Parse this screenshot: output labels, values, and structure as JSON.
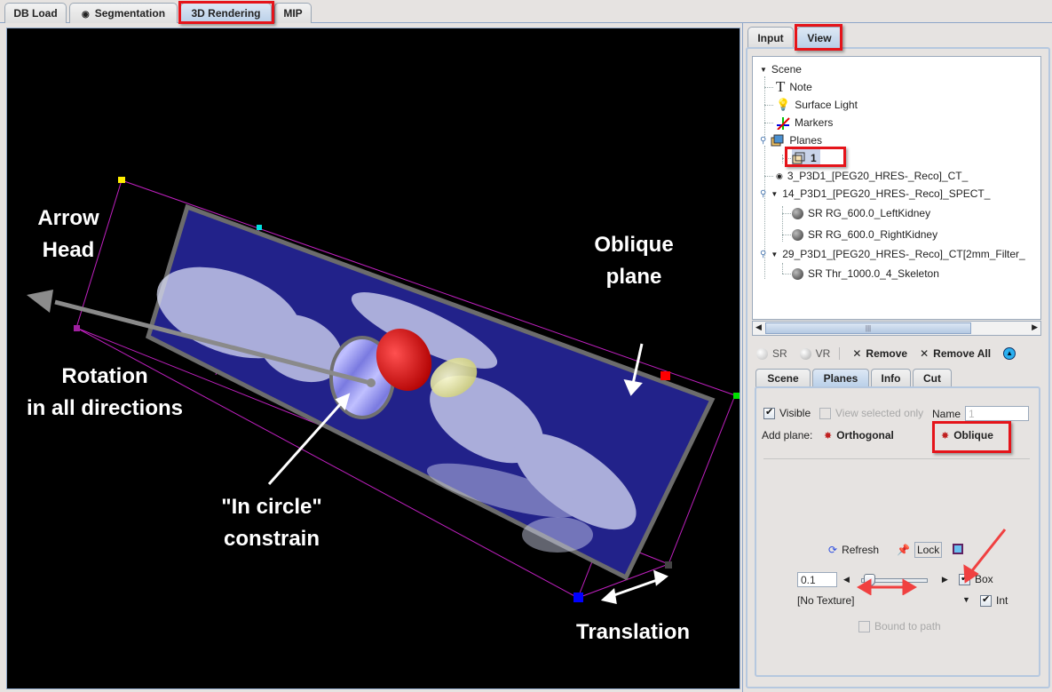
{
  "top_tabs": [
    {
      "label": "DB Load",
      "active": false
    },
    {
      "label": "Segmentation",
      "active": false,
      "icon": "target-icon"
    },
    {
      "label": "3D Rendering",
      "active": true
    },
    {
      "label": "MIP",
      "active": false
    }
  ],
  "viewport": {
    "annotations": {
      "arrow_head": "Arrow\nHead",
      "oblique_plane": "Oblique\nplane",
      "rotation": "Rotation\nin all directions",
      "in_circle": "\"In circle\"\nconstrain",
      "translation": "Translation"
    }
  },
  "side_tabs": [
    {
      "label": "Input",
      "active": false
    },
    {
      "label": "View",
      "active": true
    }
  ],
  "tree": {
    "nodes": [
      {
        "label": "Scene",
        "icon": "expand-triangle-icon"
      },
      {
        "label": "Note",
        "icon": "text-T-icon"
      },
      {
        "label": "Surface Light",
        "icon": "lightbulb-icon"
      },
      {
        "label": "Markers",
        "icon": "axes-markers-icon"
      },
      {
        "label": "Planes",
        "icon": "planes-cube-icon"
      },
      {
        "label": "1",
        "icon": "plane-cube-icon",
        "selected": true
      },
      {
        "label": "3_P3D1_[PEG20_HRES-_Reco]_CT_",
        "icon": "target-icon"
      },
      {
        "label": "14_P3D1_[PEG20_HRES-_Reco]_SPECT_",
        "icon": "expand-triangle-icon"
      },
      {
        "label": "SR RG_600.0_LeftKidney",
        "icon": "surface-sphere-icon"
      },
      {
        "label": "SR RG_600.0_RightKidney",
        "icon": "surface-sphere-icon"
      },
      {
        "label": "29_P3D1_[PEG20_HRES-_Reco]_CT[2mm_Filter_",
        "icon": "expand-triangle-icon"
      },
      {
        "label": "SR Thr_1000.0_4_Skeleton",
        "icon": "surface-sphere-icon"
      }
    ]
  },
  "toolbar": {
    "sr_label": "SR",
    "vr_label": "VR",
    "remove_label": "Remove",
    "remove_all_label": "Remove All"
  },
  "bottom_tabs": [
    {
      "label": "Scene",
      "active": false
    },
    {
      "label": "Planes",
      "active": true
    },
    {
      "label": "Info",
      "active": false
    },
    {
      "label": "Cut",
      "active": false
    }
  ],
  "planes": {
    "visible_label": "Visible",
    "visible_checked": true,
    "view_selected_label": "View selected only",
    "view_selected_checked": false,
    "name_label": "Name",
    "name_value": "1",
    "add_plane_label": "Add plane:",
    "orthogonal_label": "Orthogonal",
    "oblique_label": "Oblique",
    "refresh_label": "Refresh",
    "lock_label": "Lock",
    "step_value": "0.1",
    "slider_fraction": 0.05,
    "box_label": "Box",
    "box_checked": true,
    "texture_label": "[No Texture]",
    "int_label": "Int",
    "int_checked": true,
    "bound_label": "Bound to path",
    "bound_checked": false
  },
  "colors": {
    "highlight_red": "#e5141a",
    "plane_blue": "#22228a",
    "bbox_magenta": "#c020c0"
  }
}
